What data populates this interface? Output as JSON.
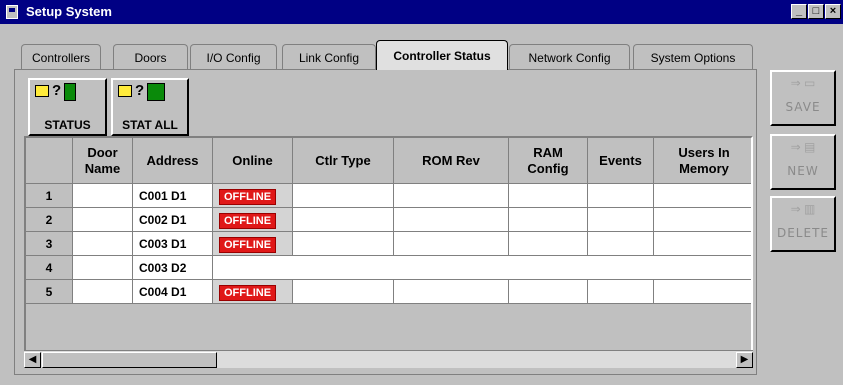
{
  "window": {
    "title": "Setup System"
  },
  "tabs": [
    {
      "label": "Controllers"
    },
    {
      "label": "Doors"
    },
    {
      "label": "I/O Config"
    },
    {
      "label": "Link Config"
    },
    {
      "label": "Controller Status"
    },
    {
      "label": "Network Config"
    },
    {
      "label": "System Options"
    }
  ],
  "toolbar": {
    "status_label": "STATUS",
    "stat_all_label": "STAT ALL"
  },
  "side_buttons": {
    "save": "SAVE",
    "new": "NEW",
    "delete": "DELETE"
  },
  "grid": {
    "headers": [
      "Door Name",
      "Address",
      "Online",
      "Ctlr Type",
      "ROM Rev",
      "RAM Config",
      "Events",
      "Users In Memory"
    ],
    "rows": [
      {
        "num": "1",
        "door_name": "",
        "address": "C001 D1",
        "online": "OFFLINE"
      },
      {
        "num": "2",
        "door_name": "",
        "address": "C002 D1",
        "online": "OFFLINE"
      },
      {
        "num": "3",
        "door_name": "",
        "address": "C003 D1",
        "online": "OFFLINE"
      },
      {
        "num": "4",
        "door_name": "",
        "address": "C003 D2",
        "online": ""
      },
      {
        "num": "5",
        "door_name": "",
        "address": "C004 D1",
        "online": "OFFLINE"
      }
    ]
  },
  "colors": {
    "offline_badge": "#e01818",
    "titlebar": "#000084"
  },
  "icons": {
    "left_arrow": "◀",
    "right_arrow": "▶"
  }
}
